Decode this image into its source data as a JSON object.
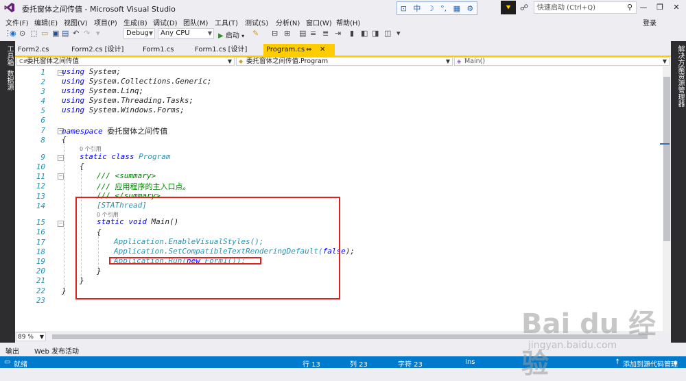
{
  "window": {
    "title": "委托窗体之间传值 - Microsoft Visual Studio",
    "ime": [
      "⊡",
      "中",
      "☽",
      "°,",
      "▦",
      "⚙"
    ],
    "quick_launch_placeholder": "快速启动 (Ctrl+Q)",
    "buttons": {
      "minimize": "—",
      "restore": "❐",
      "close": "✕"
    }
  },
  "menu": {
    "items": [
      "文件(F)",
      "编辑(E)",
      "视图(V)",
      "项目(P)",
      "生成(B)",
      "调试(D)",
      "团队(M)",
      "工具(T)",
      "测试(S)",
      "分析(N)",
      "窗口(W)",
      "帮助(H)"
    ],
    "login": "登录"
  },
  "toolbar": {
    "config": "Debug",
    "platform": "Any CPU",
    "start": "启动"
  },
  "side": {
    "left": [
      "工具箱",
      "数据源"
    ],
    "right": "解决方案资源管理器"
  },
  "tabs": [
    {
      "label": "Form2.cs"
    },
    {
      "label": "Form2.cs [设计]"
    },
    {
      "label": "Form1.cs"
    },
    {
      "label": "Form1.cs [设计]"
    },
    {
      "label": "Program.cs",
      "pin": "⇔",
      "close": "✕",
      "active": true
    }
  ],
  "nav": {
    "project": "委托窗体之间传值",
    "class": "委托窗体之间传值.Program",
    "member": "Main()"
  },
  "code": {
    "line_numbers": [
      "1",
      "2",
      "3",
      "4",
      "5",
      "6",
      "7",
      "8",
      "9",
      "10",
      "11",
      "12",
      "13",
      "14",
      "15",
      "16",
      "17",
      "18",
      "19",
      "20",
      "21",
      "22",
      "23"
    ],
    "using_kw": "using",
    "usings": [
      "System;",
      "System.Collections.Generic;",
      "System.Linq;",
      "System.Threading.Tasks;",
      "System.Windows.Forms;"
    ],
    "namespace_kw": "namespace",
    "namespace_name": "委托窗体之间传值",
    "ref_count": "0 个引用",
    "class_kw": "static class",
    "class_name": "Program",
    "summary_open": "/// <summary>",
    "summary_text_prefix": "/// ",
    "summary_text": "应用程序的主入口点。",
    "summary_close": "/// </summary>",
    "attribute": "[STAThread]",
    "main_sig_kw": "static void",
    "main_sig": "Main()",
    "stmt1": "Application.EnableVisualStyles();",
    "stmt2_a": "Application.SetCompatibleTextRenderingDefault(",
    "stmt2_kw": "false",
    "stmt2_b": ");",
    "stmt3_a": "Application.Run(",
    "stmt3_kw": "new",
    "stmt3_b": " Form1());",
    "open_brace": "{",
    "close_brace": "}"
  },
  "editor": {
    "zoom": "89 %"
  },
  "output_tabs": [
    "输出",
    "Web 发布活动"
  ],
  "status": {
    "ready": "就绪",
    "line": "行 13",
    "col": "列 23",
    "char": "字符 23",
    "mode": "Ins",
    "source_control": "添加到源代码管理"
  },
  "watermark": {
    "logo": "Bai du 经验",
    "url": "jingyan.baidu.com"
  },
  "colors": {
    "accent": "#007acc",
    "active_tab": "#ffcc00",
    "highlight_box": "#e0201e"
  }
}
